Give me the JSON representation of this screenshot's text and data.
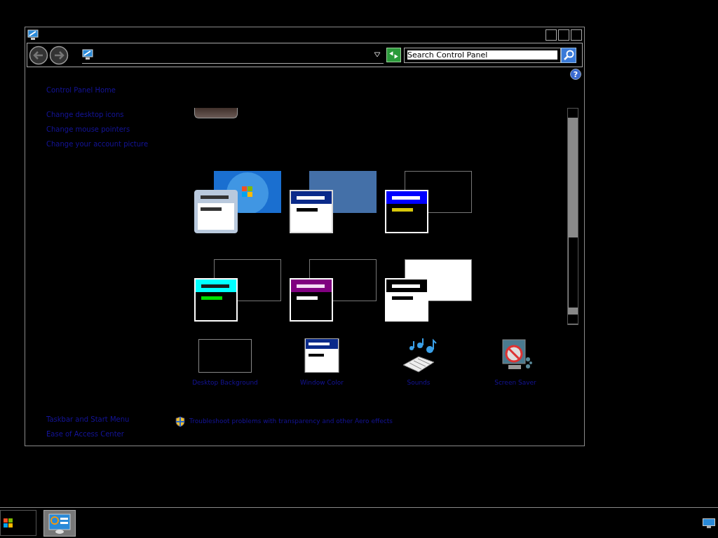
{
  "search": {
    "placeholder": "Search Control Panel"
  },
  "help": "?",
  "sidebar": {
    "links": [
      "Control Panel Home",
      "Change desktop icons",
      "Change mouse pointers",
      "Change your account picture"
    ],
    "see_also": [
      "Taskbar and Start Menu",
      "Ease of Access Center"
    ]
  },
  "themes": [
    {
      "kind": "aero",
      "desktop": {
        "color": "#1a6fd0"
      },
      "frame": {
        "color": "#b9c9dd"
      },
      "title_bar": {
        "color": "#b9c9dd"
      },
      "caption": {
        "color": "#333333"
      },
      "text_line": {
        "color": "#333333"
      },
      "body": {
        "color": "#ffffff"
      }
    },
    {
      "kind": "basic",
      "desktop": {
        "color": "#4470a8"
      },
      "frame": {
        "color": "#d8d8d8"
      },
      "title_bar": {
        "color": "#0a2a8a"
      },
      "caption": {
        "color": "#ffffff"
      },
      "text_line": {
        "color": "#000000"
      },
      "body": {
        "color": "#ffffff"
      }
    },
    {
      "kind": "contrast",
      "desktop": {
        "color": "#000000"
      },
      "frame": {
        "color": "#ffffff"
      },
      "title_bar": {
        "color": "#0000ff"
      },
      "caption": {
        "color": "#ffffff"
      },
      "text_line": {
        "color": "#d8c80a"
      },
      "body": {
        "color": "#000000"
      }
    },
    {
      "kind": "contrast",
      "desktop": {
        "color": "#000000"
      },
      "frame": {
        "color": "#ffffff"
      },
      "title_bar": {
        "color": "#00ffff"
      },
      "caption": {
        "color": "#1a1a1a"
      },
      "text_line": {
        "color": "#00e000"
      },
      "body": {
        "color": "#000000"
      }
    },
    {
      "kind": "contrast",
      "desktop": {
        "color": "#000000"
      },
      "frame": {
        "color": "#ffffff"
      },
      "title_bar": {
        "color": "#800080"
      },
      "caption": {
        "color": "#f4dcf4"
      },
      "text_line": {
        "color": "#ffffff"
      },
      "body": {
        "color": "#000000"
      }
    },
    {
      "kind": "contrast",
      "desktop": {
        "color": "#ffffff"
      },
      "frame": {
        "color": "#ffffff"
      },
      "title_bar": {
        "color": "#000000"
      },
      "caption": {
        "color": "#ffffff"
      },
      "text_line": {
        "color": "#000000"
      },
      "body": {
        "color": "#ffffff"
      }
    }
  ],
  "settings": [
    {
      "label": "Desktop Background",
      "kind": "background"
    },
    {
      "label": "Window Color",
      "kind": "color"
    },
    {
      "label": "Sounds",
      "kind": "sounds"
    },
    {
      "label": "Screen Saver",
      "kind": "screensaver"
    }
  ],
  "troubleshoot_link": "Troubleshoot problems with transparency and other Aero effects"
}
